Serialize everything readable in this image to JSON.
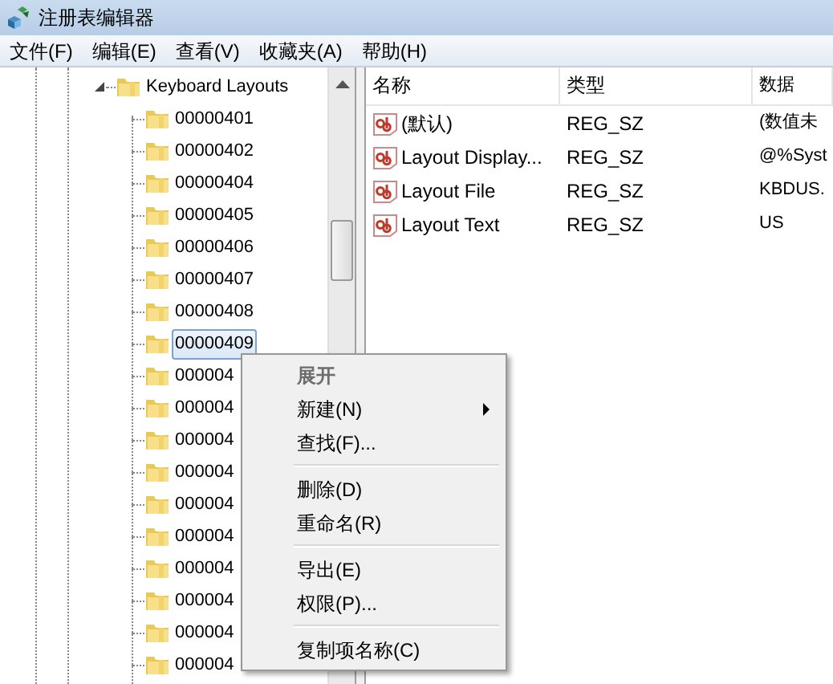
{
  "window": {
    "title": "注册表编辑器"
  },
  "menu": [
    "文件(F)",
    "编辑(E)",
    "查看(V)",
    "收藏夹(A)",
    "帮助(H)"
  ],
  "tree": {
    "label": "Keyboard Layouts",
    "expanded": true,
    "children": [
      {
        "label": "00000401",
        "selected": false
      },
      {
        "label": "00000402",
        "selected": false
      },
      {
        "label": "00000404",
        "selected": false
      },
      {
        "label": "00000405",
        "selected": false
      },
      {
        "label": "00000406",
        "selected": false
      },
      {
        "label": "00000407",
        "selected": false
      },
      {
        "label": "00000408",
        "selected": false
      },
      {
        "label": "00000409",
        "selected": true
      },
      {
        "label": "000004",
        "selected": false
      },
      {
        "label": "000004",
        "selected": false
      },
      {
        "label": "000004",
        "selected": false
      },
      {
        "label": "000004",
        "selected": false
      },
      {
        "label": "000004",
        "selected": false
      },
      {
        "label": "000004",
        "selected": false
      },
      {
        "label": "000004",
        "selected": false
      },
      {
        "label": "000004",
        "selected": false
      },
      {
        "label": "000004",
        "selected": false
      },
      {
        "label": "000004",
        "selected": false
      }
    ]
  },
  "list": {
    "columns": [
      "名称",
      "类型",
      "数据"
    ],
    "rows": [
      {
        "name": "(默认)",
        "type": "REG_SZ",
        "data": "(数值未"
      },
      {
        "name": "Layout Display...",
        "type": "REG_SZ",
        "data": "@%Syst"
      },
      {
        "name": "Layout File",
        "type": "REG_SZ",
        "data": "KBDUS."
      },
      {
        "name": "Layout Text",
        "type": "REG_SZ",
        "data": "US"
      }
    ]
  },
  "context_menu": [
    {
      "kind": "item",
      "label": "展开",
      "disabled": true,
      "default": true,
      "submenu": false
    },
    {
      "kind": "item",
      "label": "新建(N)",
      "disabled": false,
      "default": false,
      "submenu": true
    },
    {
      "kind": "item",
      "label": "查找(F)...",
      "disabled": false,
      "default": false,
      "submenu": false
    },
    {
      "kind": "separator"
    },
    {
      "kind": "item",
      "label": "删除(D)",
      "disabled": false,
      "default": false,
      "submenu": false
    },
    {
      "kind": "item",
      "label": "重命名(R)",
      "disabled": false,
      "default": false,
      "submenu": false
    },
    {
      "kind": "separator"
    },
    {
      "kind": "item",
      "label": "导出(E)",
      "disabled": false,
      "default": false,
      "submenu": false
    },
    {
      "kind": "item",
      "label": "权限(P)...",
      "disabled": false,
      "default": false,
      "submenu": false
    },
    {
      "kind": "separator"
    },
    {
      "kind": "item",
      "label": "复制项名称(C)",
      "disabled": false,
      "default": false,
      "submenu": false
    }
  ]
}
